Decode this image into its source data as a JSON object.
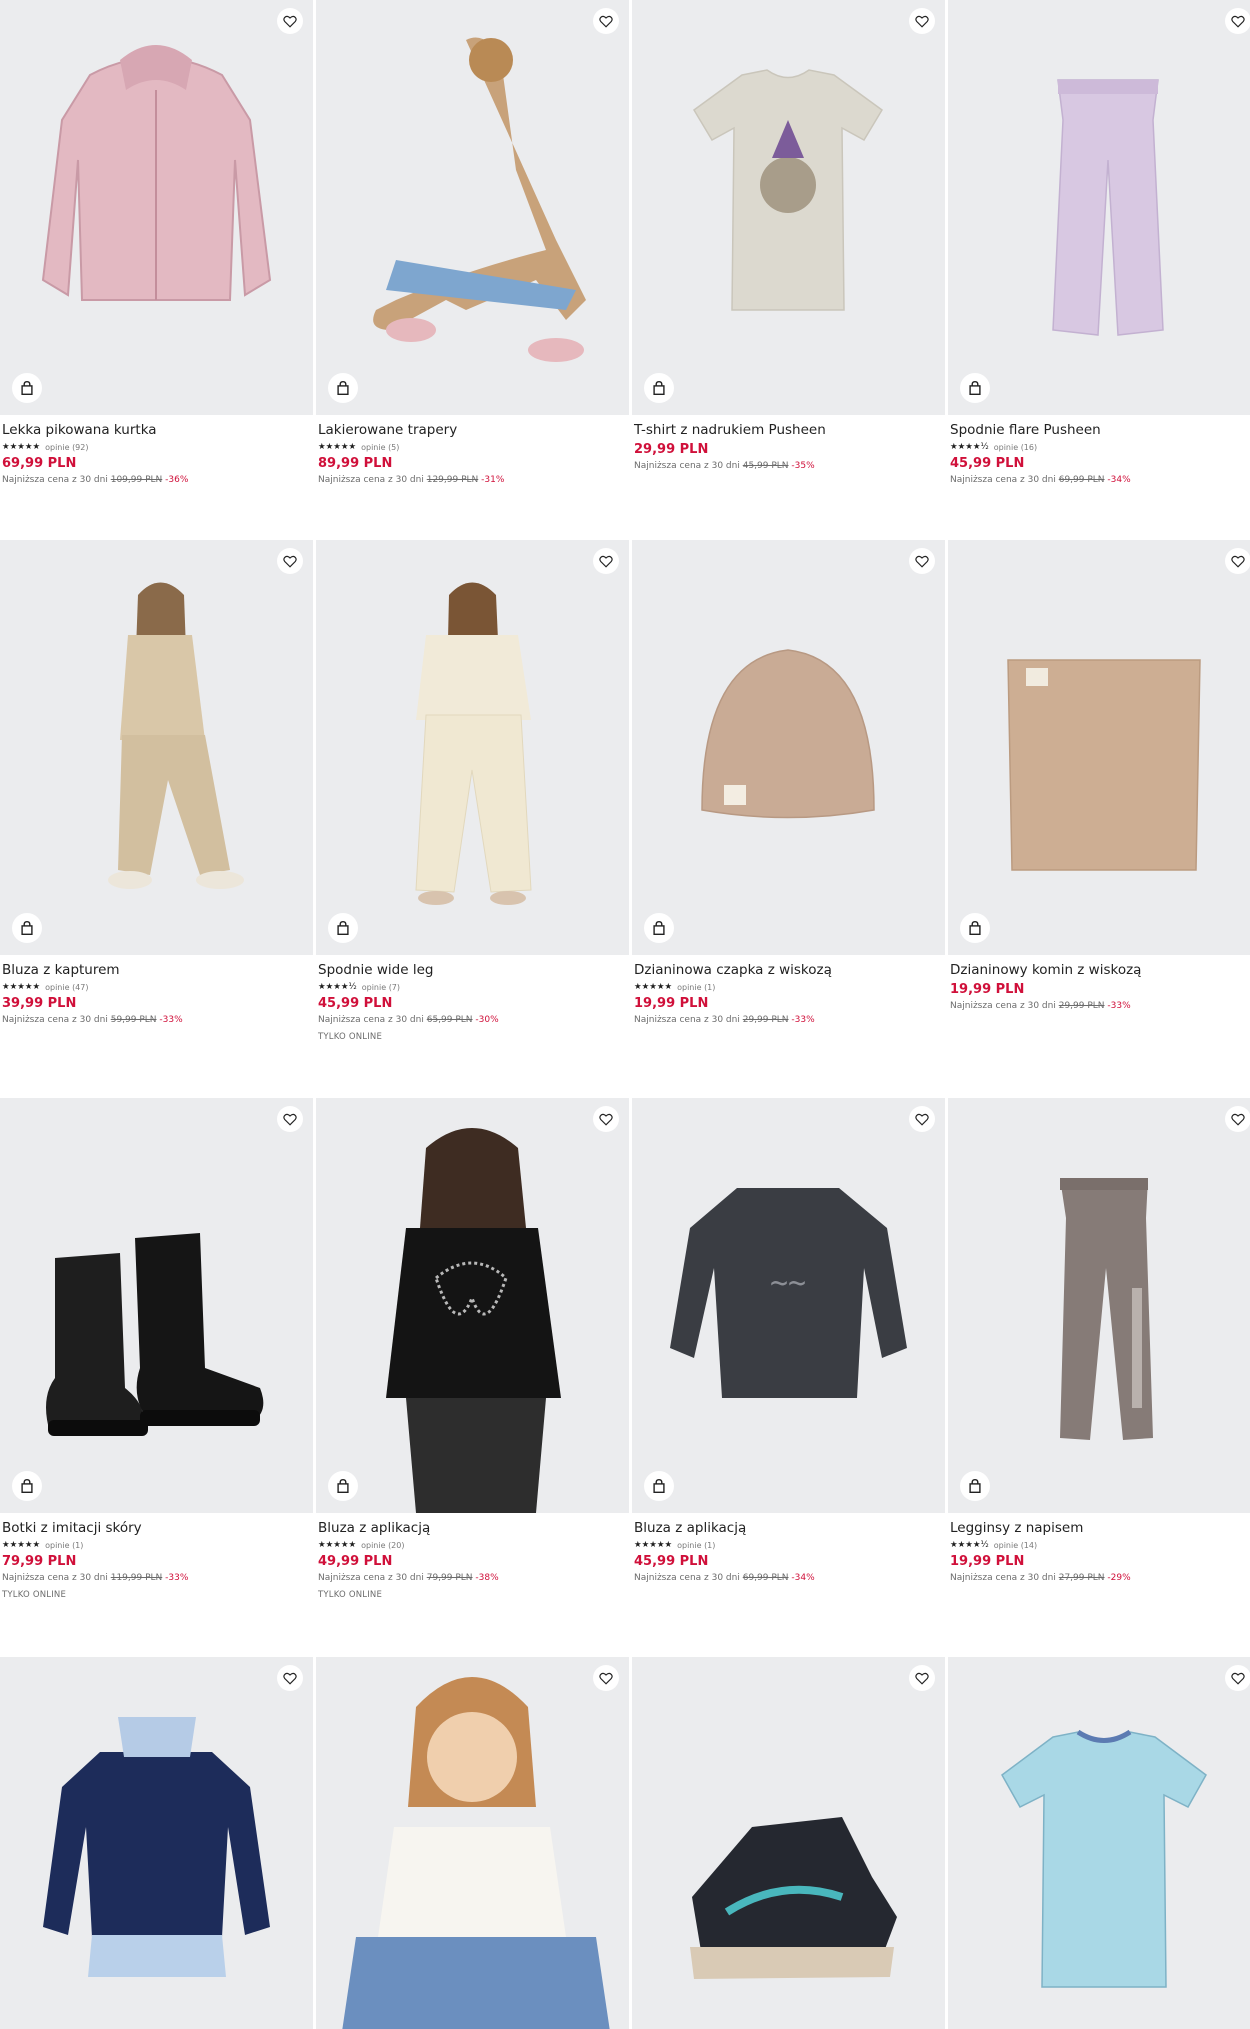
{
  "colors": {
    "price": "#d0103a",
    "text": "#222222",
    "muted": "#6c6c6c",
    "image_bg": "#ebecee"
  },
  "icons": {
    "favorite": "heart-icon",
    "cart": "bag-icon",
    "rating": "star-icon"
  },
  "lowest_label": "Najniższa cena z 30 dni",
  "products": [
    {
      "name": "Lekka pikowana kurtka",
      "stars": "★★★★★",
      "reviews": "opinie (92)",
      "price": "69,99 PLN",
      "old_price": "109,99 PLN",
      "discount": "-36%",
      "tag": ""
    },
    {
      "name": "Lakierowane trapery",
      "stars": "★★★★★",
      "reviews": "opinie (5)",
      "price": "89,99 PLN",
      "old_price": "129,99 PLN",
      "discount": "-31%",
      "tag": ""
    },
    {
      "name": "T-shirt z nadrukiem Pusheen",
      "stars": "",
      "reviews": "",
      "price": "29,99 PLN",
      "old_price": "45,99 PLN",
      "discount": "-35%",
      "tag": ""
    },
    {
      "name": "Spodnie flare Pusheen",
      "stars": "★★★★½",
      "reviews": "opinie (16)",
      "price": "45,99 PLN",
      "old_price": "69,99 PLN",
      "discount": "-34%",
      "tag": ""
    },
    {
      "name": "Bluza z kapturem",
      "stars": "★★★★★",
      "reviews": "opinie (47)",
      "price": "39,99 PLN",
      "old_price": "59,99 PLN",
      "discount": "-33%",
      "tag": ""
    },
    {
      "name": "Spodnie wide leg",
      "stars": "★★★★½",
      "reviews": "opinie (7)",
      "price": "45,99 PLN",
      "old_price": "65,99 PLN",
      "discount": "-30%",
      "tag": "TYLKO ONLINE"
    },
    {
      "name": "Dzianinowa czapka z wiskozą",
      "stars": "★★★★★",
      "reviews": "opinie (1)",
      "price": "19,99 PLN",
      "old_price": "29,99 PLN",
      "discount": "-33%",
      "tag": ""
    },
    {
      "name": "Dzianinowy komin z wiskozą",
      "stars": "",
      "reviews": "",
      "price": "19,99 PLN",
      "old_price": "29,99 PLN",
      "discount": "-33%",
      "tag": ""
    },
    {
      "name": "Botki z imitacji skóry",
      "stars": "★★★★★",
      "reviews": "opinie (1)",
      "price": "79,99 PLN",
      "old_price": "119,99 PLN",
      "discount": "-33%",
      "tag": "TYLKO ONLINE"
    },
    {
      "name": "Bluza z aplikacją",
      "stars": "★★★★★",
      "reviews": "opinie (20)",
      "price": "49,99 PLN",
      "old_price": "79,99 PLN",
      "discount": "-38%",
      "tag": "TYLKO ONLINE"
    },
    {
      "name": "Bluza z aplikacją",
      "stars": "★★★★★",
      "reviews": "opinie (1)",
      "price": "45,99 PLN",
      "old_price": "69,99 PLN",
      "discount": "-34%",
      "tag": ""
    },
    {
      "name": "Legginsy z napisem",
      "stars": "★★★★½",
      "reviews": "opinie (14)",
      "price": "19,99 PLN",
      "old_price": "27,99 PLN",
      "discount": "-29%",
      "tag": ""
    },
    {
      "name": "",
      "stars": "",
      "reviews": "",
      "price": "",
      "old_price": "",
      "discount": "",
      "tag": ""
    },
    {
      "name": "",
      "stars": "",
      "reviews": "",
      "price": "",
      "old_price": "",
      "discount": "",
      "tag": ""
    },
    {
      "name": "",
      "stars": "",
      "reviews": "",
      "price": "",
      "old_price": "",
      "discount": "",
      "tag": ""
    },
    {
      "name": "",
      "stars": "",
      "reviews": "",
      "price": "",
      "old_price": "",
      "discount": "",
      "tag": ""
    }
  ]
}
